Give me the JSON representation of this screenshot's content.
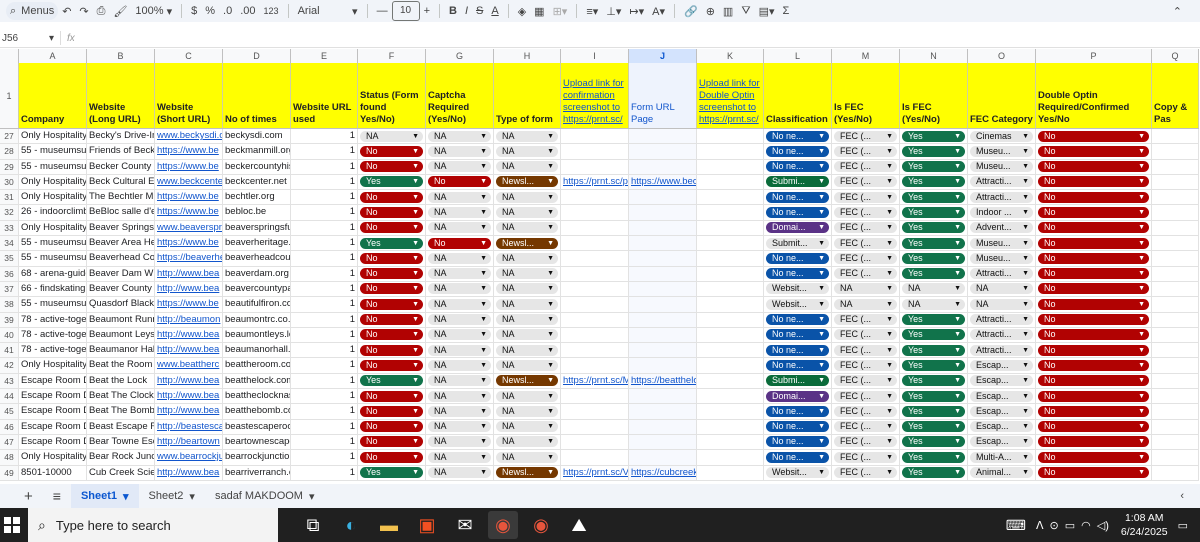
{
  "toolbar": {
    "menus": "Menus",
    "zoom": "100%",
    "currency": "$",
    "percent": "%",
    "dec_dec": ".0",
    "dec_inc": ".00",
    "format": "123",
    "font": "Arial",
    "font_size": "10",
    "bold": "B",
    "italic": "I",
    "underline_a": "A"
  },
  "formula": {
    "namebox": "J56",
    "fx": "fx"
  },
  "columns": [
    "A",
    "B",
    "C",
    "D",
    "E",
    "F",
    "G",
    "H",
    "I",
    "J",
    "K",
    "L",
    "M",
    "N",
    "O",
    "P",
    "Q"
  ],
  "selected_column": "J",
  "header_row": "1",
  "headers": {
    "A": "Company",
    "B": "Website (Long URL)",
    "C": "Website (Short URL)",
    "D": "No of times",
    "E": "Website URL used",
    "F": "Status (Form found Yes/No)",
    "G": "Captcha Required (Yes/No)",
    "H": "Type of form",
    "I": "Upload link for confirmation screenshot to https://prnt.sc/",
    "J": "Form URL Page",
    "K": "Upload link for Double Optin screenshot to https://prnt.sc/",
    "L": "Classification",
    "M": "Is FEC (Yes/No)",
    "N": "Is FEC (Yes/No)",
    "O": "FEC Category",
    "P": "Double Optin Required/Confirmed Yes/No",
    "Q": "Copy & Pas"
  },
  "rows": [
    {
      "n": "27",
      "a": "Only Hospitality:",
      "b": "Becky's Drive-In",
      "c": "www.beckysdi.c",
      "d": "beckysdi.com",
      "e": "1",
      "f": "NA",
      "g": "NA",
      "h": "NA",
      "i": "",
      "j": "",
      "k": "",
      "l": "No ne...",
      "m": "FEC (...",
      "nn": "Yes",
      "o": "Cinemas",
      "p": "No"
    },
    {
      "n": "28",
      "a": "55 - museumsus",
      "b": "Friends of Beckn",
      "c": "https://www.be",
      "d": "beckmanmill.org",
      "e": "1",
      "f": "No",
      "g": "NA",
      "h": "NA",
      "i": "",
      "j": "",
      "k": "",
      "l": "No ne...",
      "m": "FEC (...",
      "nn": "Yes",
      "o": "Museu...",
      "p": "No"
    },
    {
      "n": "29",
      "a": "55 - museumsus",
      "b": "Becker County H",
      "c": "https://www.be",
      "d": "beckercountyhis",
      "e": "1",
      "f": "No",
      "g": "NA",
      "h": "NA",
      "i": "",
      "j": "",
      "k": "",
      "l": "No ne...",
      "m": "FEC (...",
      "nn": "Yes",
      "o": "Museu...",
      "p": "No"
    },
    {
      "n": "30",
      "a": "Only Hospitality:",
      "b": "Beck Cultural Ex",
      "c": "www.beckcente",
      "d": "beckcenter.net",
      "e": "1",
      "f": "Yes",
      "g": "No",
      "h": "Newsl...",
      "i": "https://prnt.sc/pA",
      "j": "https://www.beck",
      "k": "",
      "l": "Submi...",
      "m": "FEC (...",
      "nn": "Yes",
      "o": "Attracti...",
      "p": "No"
    },
    {
      "n": "31",
      "a": "Only Hospitality:",
      "b": "The Bechtler Mu",
      "c": "https://www.be",
      "d": "bechtler.org",
      "e": "1",
      "f": "No",
      "g": "NA",
      "h": "NA",
      "i": "",
      "j": "",
      "k": "",
      "l": "No ne...",
      "m": "FEC (...",
      "nn": "Yes",
      "o": "Attracti...",
      "p": "No"
    },
    {
      "n": "32",
      "a": "26 - indoorclimb",
      "b": "BeBloc salle d'es",
      "c": "https://www.be",
      "d": "bebloc.be",
      "e": "1",
      "f": "No",
      "g": "NA",
      "h": "NA",
      "i": "",
      "j": "",
      "k": "",
      "l": "No ne...",
      "m": "FEC (...",
      "nn": "Yes",
      "o": "Indoor ...",
      "p": "No"
    },
    {
      "n": "33",
      "a": "Only Hospitality:",
      "b": "Beaver Springs",
      "c": "www.beaverspri",
      "d": "beaverspringsfu",
      "e": "1",
      "f": "No",
      "g": "NA",
      "h": "NA",
      "i": "",
      "j": "",
      "k": "",
      "l": "Domai...",
      "m": "FEC (...",
      "nn": "Yes",
      "o": "Advent...",
      "p": "No"
    },
    {
      "n": "34",
      "a": "55 - museumsus",
      "b": "Beaver Area Her",
      "c": "https://www.be",
      "d": "beaverheritage.c",
      "e": "1",
      "f": "Yes",
      "g": "No",
      "h": "Newsl...",
      "i": "",
      "j": "",
      "k": "",
      "l": "Submit...",
      "m": "FEC (...",
      "nn": "Yes",
      "o": "Museu...",
      "p": "No"
    },
    {
      "n": "35",
      "a": "55 - museumsus",
      "b": "Beaverhead Cou",
      "c": "https://beaverhe",
      "d": "beaverheadcour",
      "e": "1",
      "f": "No",
      "g": "NA",
      "h": "NA",
      "i": "",
      "j": "",
      "k": "",
      "l": "No ne...",
      "m": "FEC (...",
      "nn": "Yes",
      "o": "Museu...",
      "p": "No"
    },
    {
      "n": "36",
      "a": "68 - arena-guide",
      "b": "Beaver Dam Wir",
      "c": "http://www.bea",
      "d": "beaverdam.org",
      "e": "1",
      "f": "No",
      "g": "NA",
      "h": "NA",
      "i": "",
      "j": "",
      "k": "",
      "l": "No ne...",
      "m": "FEC (...",
      "nn": "Yes",
      "o": "Attracti...",
      "p": "No"
    },
    {
      "n": "37",
      "a": "66 - findskatingr",
      "b": "Beaver County Ic",
      "c": "http://www.bea",
      "d": "beavercountypa",
      "e": "1",
      "f": "No",
      "g": "NA",
      "h": "NA",
      "i": "",
      "j": "",
      "k": "",
      "l": "Websit...",
      "m": "NA",
      "nn": "NA",
      "o": "NA",
      "p": "No"
    },
    {
      "n": "38",
      "a": "55 - museumsus",
      "b": "Quasdorf Blacks",
      "c": "https://www.be",
      "d": "beautifulfiron.co",
      "e": "1",
      "f": "No",
      "g": "NA",
      "h": "NA",
      "i": "",
      "j": "",
      "k": "",
      "l": "Websit...",
      "m": "NA",
      "nn": "NA",
      "o": "NA",
      "p": "No"
    },
    {
      "n": "39",
      "a": "78 - active-toget",
      "b": "Beaumont Runn",
      "c": "http://beaumon",
      "d": "beaumontrc.co.",
      "e": "1",
      "f": "No",
      "g": "NA",
      "h": "NA",
      "i": "",
      "j": "",
      "k": "",
      "l": "No ne...",
      "m": "FEC (...",
      "nn": "Yes",
      "o": "Attracti...",
      "p": "No"
    },
    {
      "n": "40",
      "a": "78 - active-toget",
      "b": "Beaumont Leys",
      "c": "http://www.bea",
      "d": "beaumontleys.le",
      "e": "1",
      "f": "No",
      "g": "NA",
      "h": "NA",
      "i": "",
      "j": "",
      "k": "",
      "l": "No ne...",
      "m": "FEC (...",
      "nn": "Yes",
      "o": "Attracti...",
      "p": "No"
    },
    {
      "n": "41",
      "a": "78 - active-toget",
      "b": "Beaumanor Hall",
      "c": "http://www.bea",
      "d": "beaumanorhall.c",
      "e": "1",
      "f": "No",
      "g": "NA",
      "h": "NA",
      "i": "",
      "j": "",
      "k": "",
      "l": "No ne...",
      "m": "FEC (...",
      "nn": "Yes",
      "o": "Attracti...",
      "p": "No"
    },
    {
      "n": "42",
      "a": "Only Hospitality:",
      "b": "Beat the Room",
      "c": "www.beattherc",
      "d": "beattheroom.co",
      "e": "1",
      "f": "No",
      "g": "NA",
      "h": "NA",
      "i": "",
      "j": "",
      "k": "",
      "l": "No ne...",
      "m": "FEC (...",
      "nn": "Yes",
      "o": "Escap...",
      "p": "No"
    },
    {
      "n": "43",
      "a": "Escape Room Di",
      "b": "Beat the Lock",
      "c": "http://www.bea",
      "d": "beatthelock.com",
      "e": "1",
      "f": "Yes",
      "g": "NA",
      "h": "Newsl...",
      "i": "https://prnt.sc/Ml",
      "j": "https://beatthelo",
      "k": "",
      "l": "Submi...",
      "m": "FEC (...",
      "nn": "Yes",
      "o": "Escap...",
      "p": "No"
    },
    {
      "n": "44",
      "a": "Escape Room Di",
      "b": "Beat The Clock N",
      "c": "http://www.bea",
      "d": "beattheclocknas",
      "e": "1",
      "f": "No",
      "g": "NA",
      "h": "NA",
      "i": "",
      "j": "",
      "k": "",
      "l": "Domai...",
      "m": "FEC (...",
      "nn": "Yes",
      "o": "Escap...",
      "p": "No"
    },
    {
      "n": "45",
      "a": "Escape Room Di",
      "b": "Beat The Bomb",
      "c": "http://www.bea",
      "d": "beatthebomb.co",
      "e": "1",
      "f": "No",
      "g": "NA",
      "h": "NA",
      "i": "",
      "j": "",
      "k": "",
      "l": "No ne...",
      "m": "FEC (...",
      "nn": "Yes",
      "o": "Escap...",
      "p": "No"
    },
    {
      "n": "46",
      "a": "Escape Room Di",
      "b": "Beast Escape Ro",
      "c": "http://beastesca",
      "d": "beastescaperoor",
      "e": "1",
      "f": "No",
      "g": "NA",
      "h": "NA",
      "i": "",
      "j": "",
      "k": "",
      "l": "No ne...",
      "m": "FEC (...",
      "nn": "Yes",
      "o": "Escap...",
      "p": "No"
    },
    {
      "n": "47",
      "a": "Escape Room Di",
      "b": "Bear Towne Esca",
      "c": "http://beartown",
      "d": "beartownescape",
      "e": "1",
      "f": "No",
      "g": "NA",
      "h": "NA",
      "i": "",
      "j": "",
      "k": "",
      "l": "No ne...",
      "m": "FEC (...",
      "nn": "Yes",
      "o": "Escap...",
      "p": "No"
    },
    {
      "n": "48",
      "a": "Only Hospitality:",
      "b": "Bear Rock Juncti",
      "c": "www.bearrockju",
      "d": "bearrockjunctior",
      "e": "1",
      "f": "No",
      "g": "NA",
      "h": "NA",
      "i": "",
      "j": "",
      "k": "",
      "l": "No ne...",
      "m": "FEC (...",
      "nn": "Yes",
      "o": "Multi-A...",
      "p": "No"
    },
    {
      "n": "49",
      "a": "8501-10000",
      "b": "Cub Creek Scienc",
      "c": "http://www.bea",
      "d": "bearriverranch.c",
      "e": "1",
      "f": "Yes",
      "g": "NA",
      "h": "Newsl...",
      "i": "https://prnt.sc/V>",
      "j": "https://cubcreeks",
      "k": "",
      "l": "Websit...",
      "m": "FEC (...",
      "nn": "Yes",
      "o": "Animal...",
      "p": "No"
    }
  ],
  "sheets": {
    "add": "+",
    "list": "≡",
    "tabs": [
      "Sheet1",
      "Sheet2",
      "sadaf MAKDOOM"
    ],
    "active": "Sheet1"
  },
  "taskbar": {
    "search_placeholder": "Type here to search",
    "time": "1:08 AM",
    "date": "6/24/2025"
  },
  "chip_colors": {
    "No": "c-red",
    "Yes": "c-green",
    "NA": "c-grey",
    "Newsl...": "c-brown",
    "No ne...": "c-blue",
    "Submi...": "c-olive",
    "Domai...": "c-purple",
    "Websit...": "c-grey",
    "Submit...": "c-grey",
    "FEC (...": "c-grey",
    "Cinemas": "c-grey",
    "Museu...": "c-grey",
    "Attracti...": "c-grey",
    "Indoor ...": "c-grey",
    "Advent...": "c-grey",
    "Escap...": "c-grey",
    "Multi-A...": "c-grey",
    "Animal...": "c-grey"
  }
}
